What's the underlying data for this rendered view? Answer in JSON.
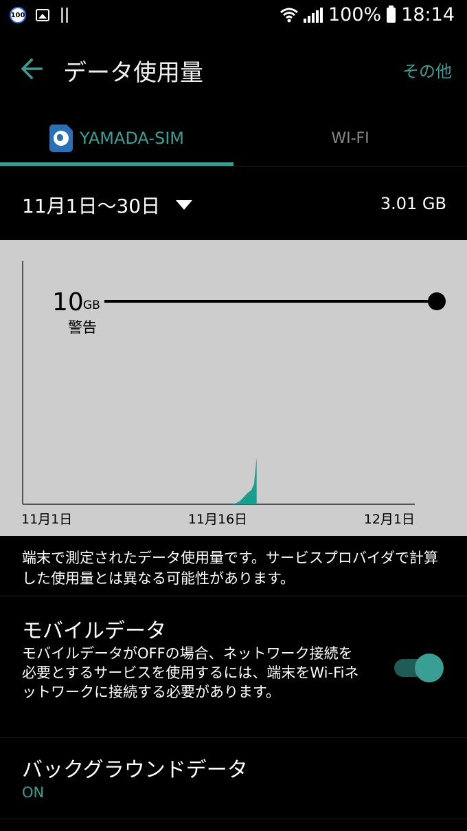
{
  "statusbar": {
    "badge": "100",
    "battery": "100%",
    "time": "18:14"
  },
  "appbar": {
    "title": "データ使用量",
    "more_label": "その他"
  },
  "tabs": [
    {
      "label": "YAMADA-SIM",
      "selected": true,
      "icon": "sim-globe-icon"
    },
    {
      "label": "WI-FI",
      "selected": false
    }
  ],
  "period": {
    "range_label": "11月1日～30日",
    "total_usage": "3.01 GB"
  },
  "chart_data": {
    "type": "area",
    "warning": {
      "value": "10",
      "unit": "GB",
      "label": "警告"
    },
    "x_tick_labels": [
      "11月1日",
      "11月16日",
      "12月1日"
    ],
    "xlim": [
      "11月1日",
      "12月1日"
    ],
    "series_color": "#179e8e",
    "series": [
      {
        "values": [
          {
            "day": 17.0,
            "gb": 0.0
          },
          {
            "day": 17.3,
            "gb": 0.05
          },
          {
            "day": 17.6,
            "gb": 0.15
          },
          {
            "day": 17.9,
            "gb": 0.35
          },
          {
            "day": 18.2,
            "gb": 0.55
          },
          {
            "day": 18.5,
            "gb": 0.7
          },
          {
            "day": 18.7,
            "gb": 1.0
          },
          {
            "day": 18.9,
            "gb": 2.3
          }
        ]
      }
    ],
    "ylim": [
      0,
      12
    ]
  },
  "description": "端末で測定されたデータ使用量です。サービスプロバイダで計算した使用量とは異なる可能性があります。",
  "mobile_data": {
    "title": "モバイルデータ",
    "description": "モバイルデータがOFFの場合、ネットワーク接続を必要とするサービスを使用するには、端末をWi-Fiネットワークに接続する必要があります。",
    "enabled": true
  },
  "background_data": {
    "title": "バックグラウンドデータ",
    "status": "ON"
  },
  "colors": {
    "accent": "#3a9e95",
    "chart_bg": "#cdcdcd"
  }
}
